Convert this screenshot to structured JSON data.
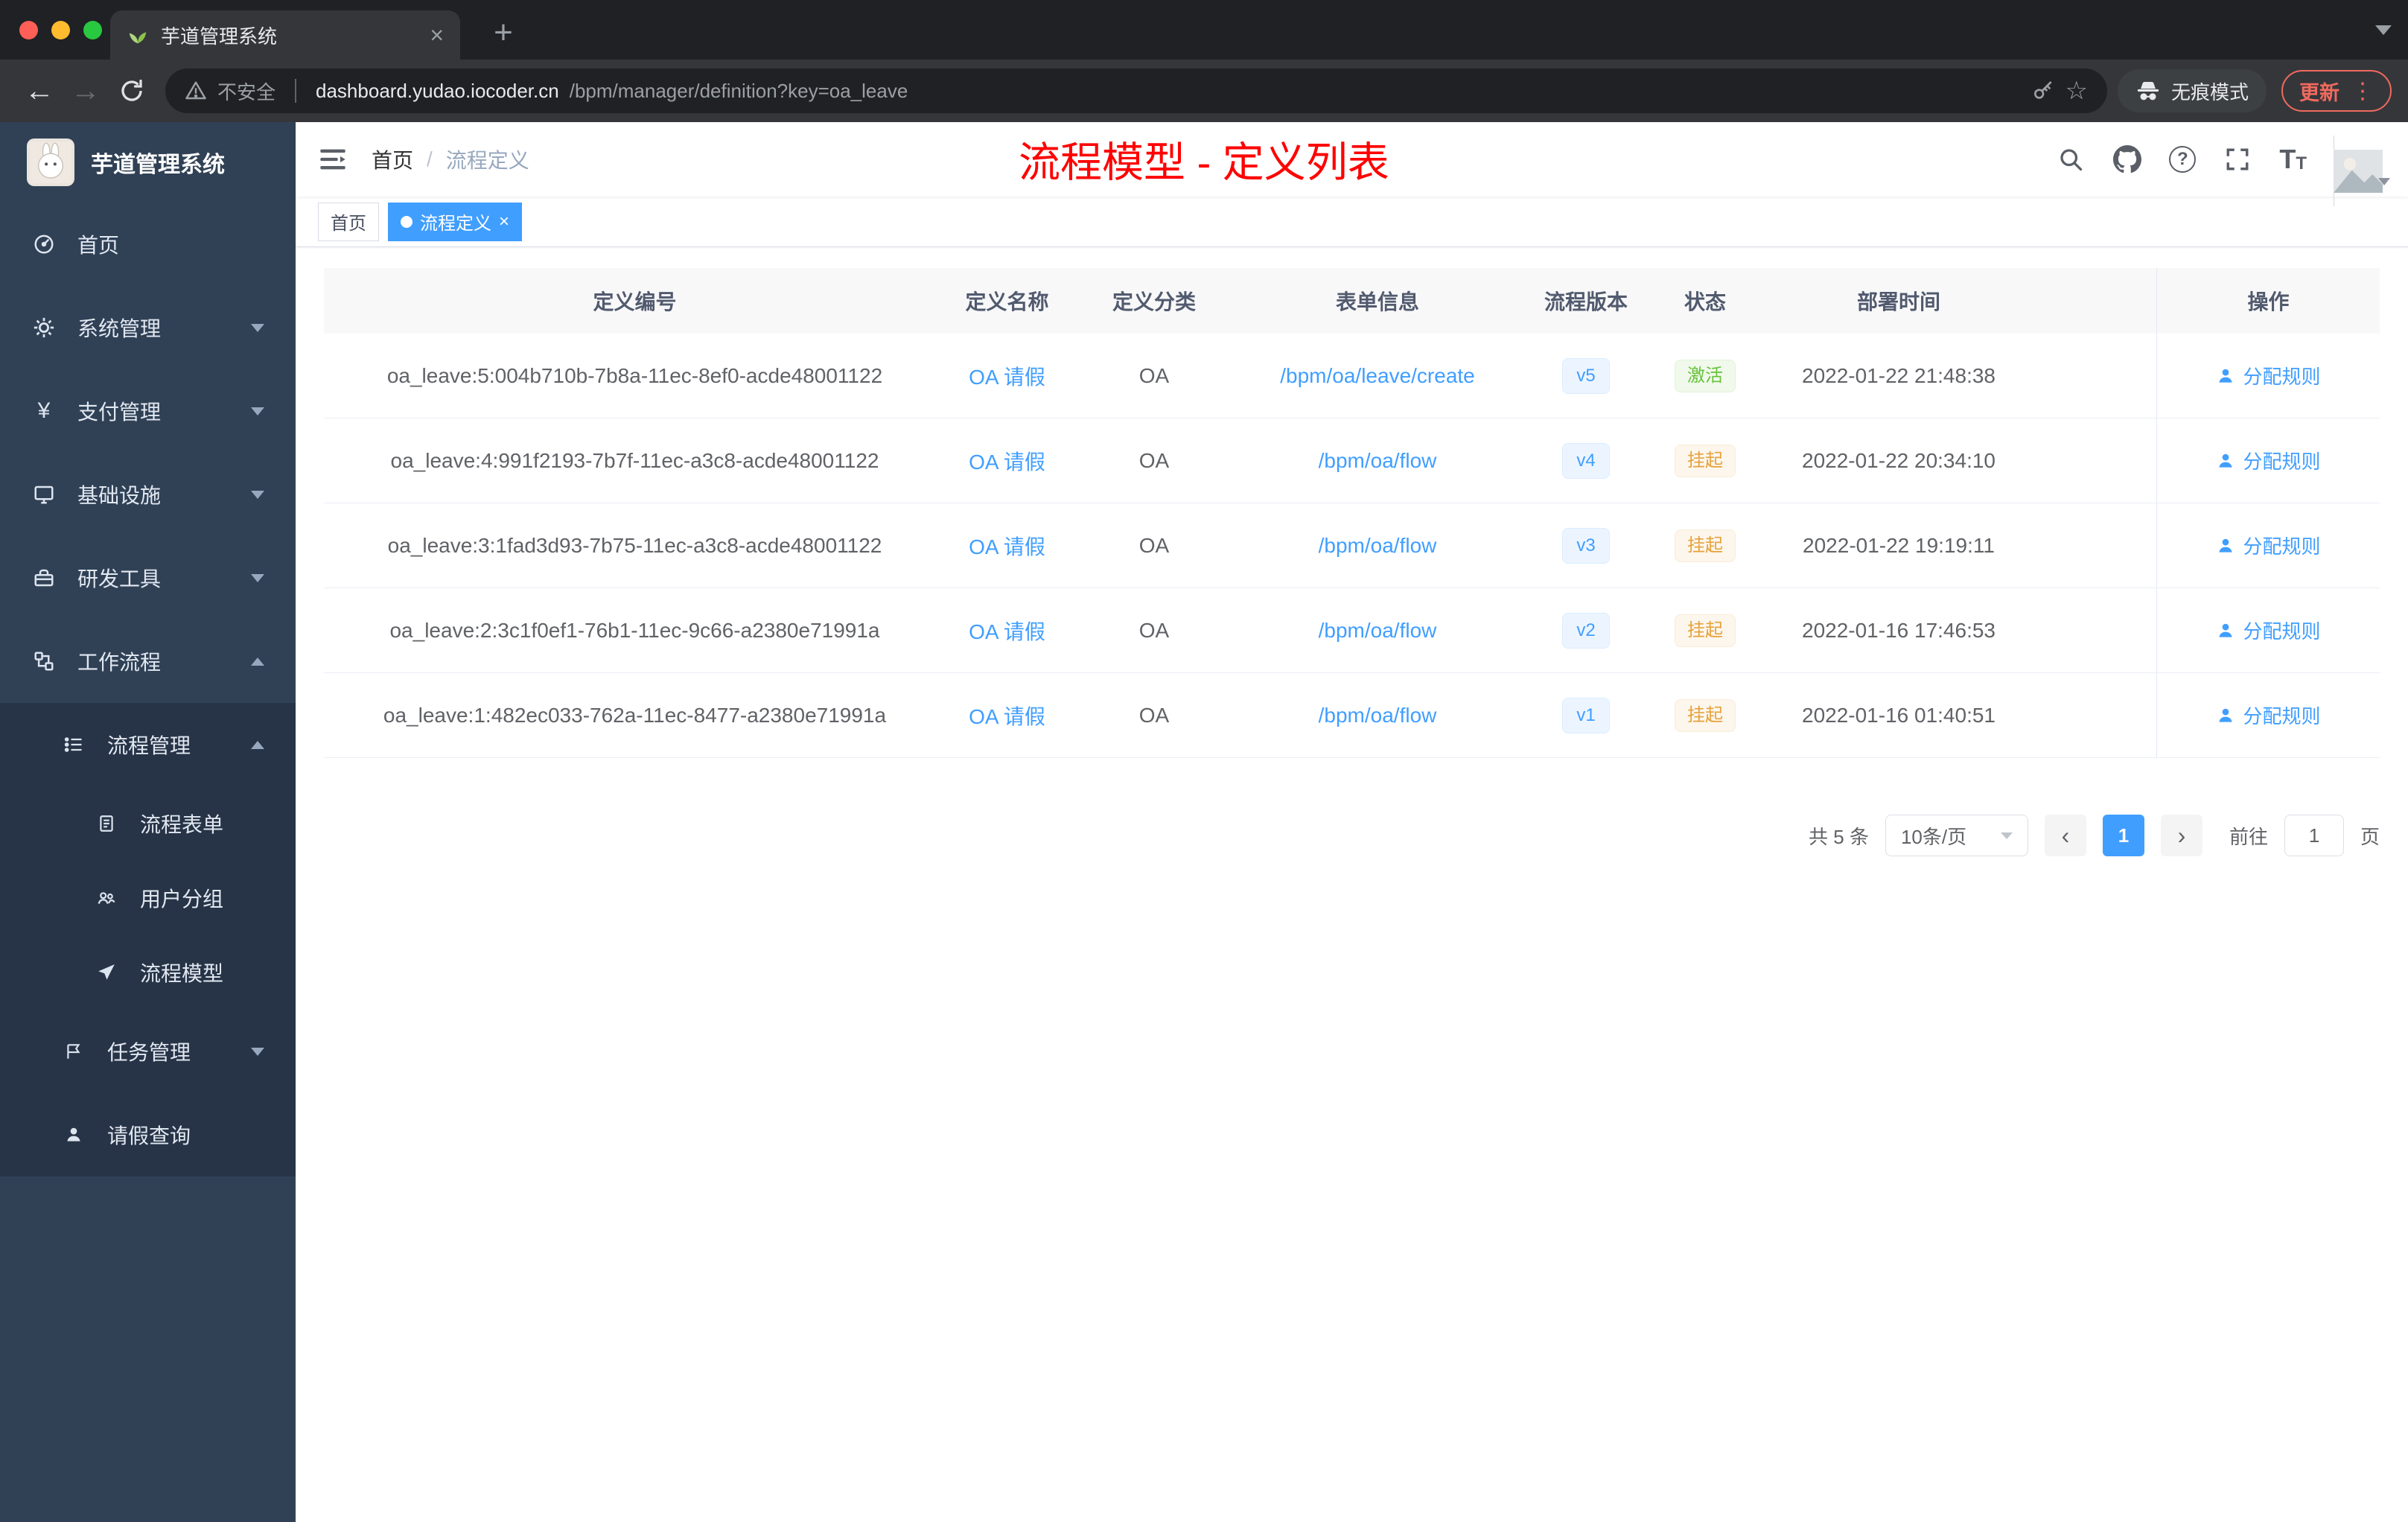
{
  "browser": {
    "tab_title": "芋道管理系统",
    "security_label": "不安全",
    "url_host": "dashboard.yudao.iocoder.cn",
    "url_path": "/bpm/manager/definition?key=oa_leave",
    "incognito_label": "无痕模式",
    "update_label": "更新"
  },
  "icons": {
    "back": "←",
    "forward": "→",
    "star": "☆",
    "dots": "⋮",
    "close": "×",
    "plus": "+",
    "yen": "¥",
    "prev": "‹",
    "next": "›",
    "question": "?",
    "textsize": "T"
  },
  "sidebar": {
    "logo_title": "芋道管理系统",
    "items": [
      {
        "label": "首页"
      },
      {
        "label": "系统管理"
      },
      {
        "label": "支付管理"
      },
      {
        "label": "基础设施"
      },
      {
        "label": "研发工具"
      },
      {
        "label": "工作流程"
      },
      {
        "label": "流程管理"
      },
      {
        "label": "流程表单"
      },
      {
        "label": "用户分组"
      },
      {
        "label": "流程模型"
      },
      {
        "label": "任务管理"
      },
      {
        "label": "请假查询"
      }
    ]
  },
  "header": {
    "breadcrumb_home": "首页",
    "breadcrumb_separator": "/",
    "breadcrumb_current": "流程定义",
    "annotation": "流程模型 - 定义列表"
  },
  "tags": [
    {
      "label": "首页"
    },
    {
      "label": "流程定义"
    }
  ],
  "table": {
    "columns": [
      "定义编号",
      "定义名称",
      "定义分类",
      "表单信息",
      "流程版本",
      "状态",
      "部署时间",
      "操作"
    ],
    "rows": [
      {
        "id": "oa_leave:5:004b710b-7b8a-11ec-8ef0-acde48001122",
        "name": "OA 请假",
        "category": "OA",
        "form": "/bpm/oa/leave/create",
        "version": "v5",
        "status": "激活",
        "time": "2022-01-22 21:48:38",
        "action": "分配规则"
      },
      {
        "id": "oa_leave:4:991f2193-7b7f-11ec-a3c8-acde48001122",
        "name": "OA 请假",
        "category": "OA",
        "form": "/bpm/oa/flow",
        "version": "v4",
        "status": "挂起",
        "time": "2022-01-22 20:34:10",
        "action": "分配规则"
      },
      {
        "id": "oa_leave:3:1fad3d93-7b75-11ec-a3c8-acde48001122",
        "name": "OA 请假",
        "category": "OA",
        "form": "/bpm/oa/flow",
        "version": "v3",
        "status": "挂起",
        "time": "2022-01-22 19:19:11",
        "action": "分配规则"
      },
      {
        "id": "oa_leave:2:3c1f0ef1-76b1-11ec-9c66-a2380e71991a",
        "name": "OA 请假",
        "category": "OA",
        "form": "/bpm/oa/flow",
        "version": "v2",
        "status": "挂起",
        "time": "2022-01-16 17:46:53",
        "action": "分配规则"
      },
      {
        "id": "oa_leave:1:482ec033-762a-11ec-8477-a2380e71991a",
        "name": "OA 请假",
        "category": "OA",
        "form": "/bpm/oa/flow",
        "version": "v1",
        "status": "挂起",
        "time": "2022-01-16 01:40:51",
        "action": "分配规则"
      }
    ]
  },
  "pagination": {
    "total": "共 5 条",
    "page_size": "10条/页",
    "page": "1",
    "goto_label": "前往",
    "goto_value": "1",
    "page_unit": "页"
  },
  "colors": {
    "accent": "#409eff",
    "success": "#67c23a",
    "warning": "#e6a23c",
    "sidebar_bg": "#304156",
    "annotation": "#ff0000"
  }
}
